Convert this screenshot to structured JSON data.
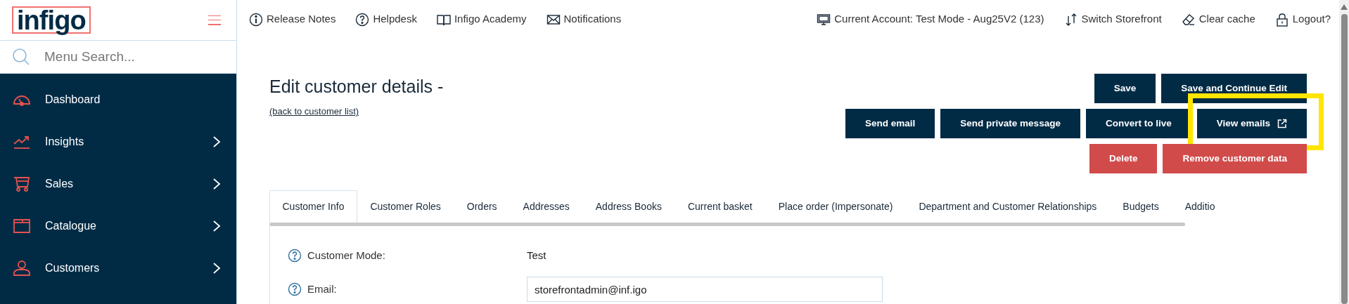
{
  "logo": "infigo",
  "menu_search": {
    "placeholder": "Menu Search..."
  },
  "sidebar": {
    "items": [
      {
        "label": "Dashboard",
        "has_children": false
      },
      {
        "label": "Insights",
        "has_children": true
      },
      {
        "label": "Sales",
        "has_children": true
      },
      {
        "label": "Catalogue",
        "has_children": true
      },
      {
        "label": "Customers",
        "has_children": true
      }
    ]
  },
  "top_links": [
    {
      "label": "Release Notes"
    },
    {
      "label": "Helpdesk"
    },
    {
      "label": "Infigo Academy"
    },
    {
      "label": "Notifications"
    }
  ],
  "top_right_links": [
    {
      "label": "Current Account: Test Mode - Aug25V2 (123)"
    },
    {
      "label": "Switch Storefront"
    },
    {
      "label": "Clear cache"
    },
    {
      "label": "Logout?"
    }
  ],
  "page": {
    "title": "Edit customer details -",
    "back_link": "(back to customer list)"
  },
  "button_rows": [
    [
      {
        "label": "Save",
        "kind": "primary"
      },
      {
        "label": "Save and Continue Edit",
        "kind": "primary"
      }
    ],
    [
      {
        "label": "Send email",
        "kind": "primary"
      },
      {
        "label": "Send private message",
        "kind": "primary"
      },
      {
        "label": "Convert to live",
        "kind": "primary"
      },
      {
        "label": "View emails",
        "kind": "primary",
        "external": true,
        "highlighted": true
      }
    ],
    [
      {
        "label": "Delete",
        "kind": "danger"
      },
      {
        "label": "Remove customer data",
        "kind": "danger"
      }
    ]
  ],
  "tabs": [
    {
      "label": "Customer Info",
      "selected": true
    },
    {
      "label": "Customer Roles",
      "selected": false
    },
    {
      "label": "Orders",
      "selected": false
    },
    {
      "label": "Addresses",
      "selected": false
    },
    {
      "label": "Address Books",
      "selected": false
    },
    {
      "label": "Current basket",
      "selected": false
    },
    {
      "label": "Place order (Impersonate)",
      "selected": false
    },
    {
      "label": "Department and Customer Relationships",
      "selected": false
    },
    {
      "label": "Budgets",
      "selected": false
    },
    {
      "label": "Additio",
      "selected": false
    }
  ],
  "form": [
    {
      "label": "Customer Mode:",
      "kind": "text",
      "value": "Test"
    },
    {
      "label": "Email:",
      "kind": "input",
      "value": "storefrontadmin@inf.igo"
    }
  ]
}
